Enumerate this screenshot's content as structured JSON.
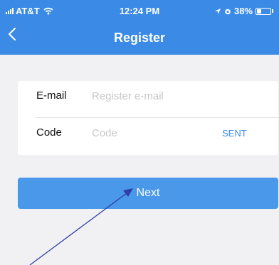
{
  "status_bar": {
    "carrier": "AT&T",
    "time": "12:24 PM",
    "battery_percent": "38%",
    "battery_level": 0.38,
    "icons": [
      "signal-icon",
      "wifi-icon",
      "location-icon",
      "alarm-icon",
      "battery-icon"
    ]
  },
  "nav": {
    "title": "Register",
    "back_icon": "chevron-left-icon"
  },
  "form": {
    "email": {
      "label": "E-mail",
      "placeholder": "Register e-mail",
      "value": ""
    },
    "code": {
      "label": "Code",
      "placeholder": "Code",
      "value": "",
      "send_label": "SENT"
    }
  },
  "next_label": "Next",
  "colors": {
    "header": "#3a8ae6",
    "button": "#4a98ea",
    "accent": "#3a8ae6",
    "background": "#f1f1f3",
    "annotation_arrow": "#2f3ea8"
  }
}
